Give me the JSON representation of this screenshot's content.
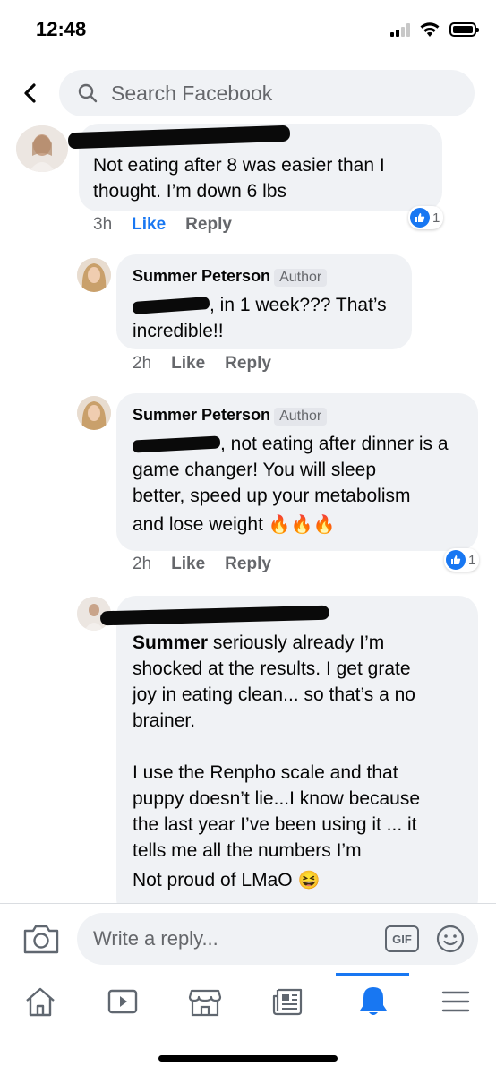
{
  "status_bar": {
    "time": "12:48"
  },
  "search": {
    "placeholder": "Search Facebook"
  },
  "comments": [
    {
      "text": "Not eating after 8 was easier than I thought. I’m down 6 lbs",
      "time": "3h",
      "like_label": "Like",
      "reply_label": "Reply",
      "reaction_count": "1"
    },
    {
      "author": "Summer Peterson",
      "author_tag": "Author",
      "text_part1": ", in 1 week??? That’s",
      "text_part2": "incredible!!",
      "time": "2h",
      "like_label": "Like",
      "reply_label": "Reply"
    },
    {
      "author": "Summer Peterson",
      "author_tag": "Author",
      "line1": ", not eating after dinner is a",
      "line2": "game changer! You will sleep",
      "line3": "better, speed up your metabolism",
      "line4": "and lose weight",
      "emoji": "🔥🔥🔥",
      "time": "2h",
      "like_label": "Like",
      "reply_label": "Reply",
      "reaction_count": "1"
    },
    {
      "mention": "Summer",
      "line1": " seriously already I’m",
      "line2": "shocked at the results. I get grate",
      "line3": "joy in eating clean... so that’s a no",
      "line4": "brainer.",
      "line5": "I use the Renpho scale and that",
      "line6": "puppy doesn’t lie...I know because",
      "line7": "the last year I’ve been using it ... it",
      "line8": "tells me all the numbers I’m",
      "line9": "Not proud of LMaO",
      "emoji": "😆"
    }
  ],
  "reply_bar": {
    "placeholder": "Write a reply...",
    "gif_label": "GIF"
  },
  "colors": {
    "accent": "#1877f2",
    "bubble": "#f0f2f5",
    "muted": "#65676b"
  },
  "tabs": [
    "home-icon",
    "watch-icon",
    "marketplace-icon",
    "news-icon",
    "notifications-icon",
    "menu-icon"
  ],
  "active_tab": "notifications-icon"
}
